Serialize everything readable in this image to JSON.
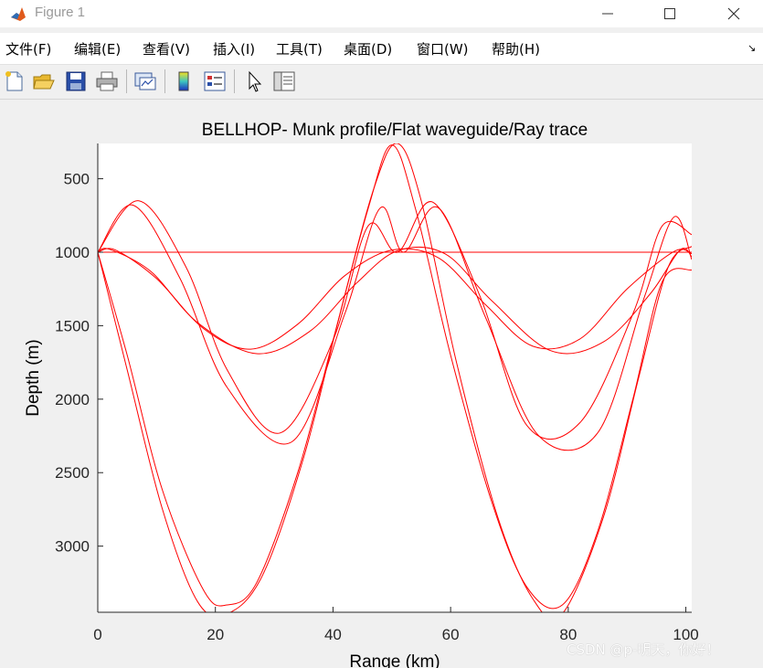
{
  "window": {
    "title": "Figure 1"
  },
  "menu": {
    "items": [
      "文件(F)",
      "编辑(E)",
      "查看(V)",
      "插入(I)",
      "工具(T)",
      "桌面(D)",
      "窗口(W)",
      "帮助(H)"
    ]
  },
  "toolbar": {
    "icons": [
      "new-figure-icon",
      "open-file-icon",
      "save-icon",
      "print-icon",
      "link-plot-icon",
      "colorbar-icon",
      "legend-icon",
      "pointer-icon",
      "property-inspector-icon"
    ]
  },
  "chart_data": {
    "type": "line",
    "title": "BELLHOP- Munk profile/Flat waveguide/Ray trace",
    "xlabel": "Range (km)",
    "ylabel": "Depth (m)",
    "xlim": [
      0,
      101
    ],
    "ylim": [
      3450,
      260
    ],
    "y_reversed": true,
    "xticks": [
      0,
      20,
      40,
      60,
      80,
      100
    ],
    "yticks": [
      500,
      1000,
      1500,
      2000,
      2500,
      3000
    ],
    "line_color": "#ff0000",
    "grid": false,
    "series": [
      {
        "x": [
          0,
          12.8,
          25.6,
          38.4,
          51.2,
          64.0,
          76.8,
          89.6,
          101
        ],
        "y": [
          1000,
          1000,
          1000,
          1000,
          1000,
          1000,
          1000,
          1000,
          1000
        ]
      },
      {
        "x": [
          0,
          3,
          10,
          18,
          26,
          34,
          42,
          50,
          58,
          66,
          74,
          82,
          90,
          98,
          101
        ],
        "y": [
          1000,
          985,
          1180,
          1520,
          1660,
          1490,
          1160,
          985,
          1040,
          1360,
          1640,
          1590,
          1250,
          995,
          1010
        ]
      },
      {
        "x": [
          0,
          2,
          9,
          17,
          27,
          36,
          44,
          51,
          59,
          67,
          77,
          86,
          94,
          99,
          101
        ],
        "y": [
          1000,
          980,
          1130,
          1480,
          1690,
          1540,
          1210,
          990,
          1010,
          1330,
          1670,
          1610,
          1280,
          985,
          1030
        ]
      },
      {
        "x": [
          0,
          7,
          15,
          22,
          31,
          40,
          46,
          51,
          57,
          65,
          73,
          82,
          91,
          96,
          101
        ],
        "y": [
          1000,
          650,
          1100,
          1800,
          2230,
          1600,
          820,
          1000,
          660,
          1300,
          2180,
          2160,
          1420,
          820,
          880
        ]
      },
      {
        "x": [
          0,
          6,
          14,
          22,
          33,
          42,
          48,
          52,
          58,
          66,
          75,
          85,
          93,
          98,
          101
        ],
        "y": [
          1000,
          680,
          1180,
          1920,
          2290,
          1420,
          700,
          1000,
          700,
          1450,
          2250,
          2230,
          1300,
          760,
          1050
        ]
      },
      {
        "x": [
          0,
          5,
          11,
          18,
          22,
          27,
          34,
          40,
          46,
          50,
          54,
          60,
          67,
          73,
          79,
          85,
          91,
          96,
          101
        ],
        "y": [
          1000,
          1700,
          2620,
          3300,
          3400,
          3250,
          2500,
          1600,
          700,
          270,
          700,
          1700,
          2700,
          3280,
          3400,
          2900,
          2000,
          1200,
          1120
        ]
      },
      {
        "x": [
          0,
          5,
          11,
          17,
          22,
          28,
          35,
          41,
          47,
          51,
          55,
          61,
          68,
          74,
          79,
          86,
          92,
          97,
          101
        ],
        "y": [
          1000,
          1800,
          2750,
          3380,
          3460,
          3200,
          2400,
          1450,
          560,
          260,
          650,
          1750,
          2800,
          3360,
          3460,
          2800,
          1850,
          1100,
          960
        ]
      }
    ]
  },
  "watermark": {
    "text": "CSDN @p-明天，你好！"
  }
}
